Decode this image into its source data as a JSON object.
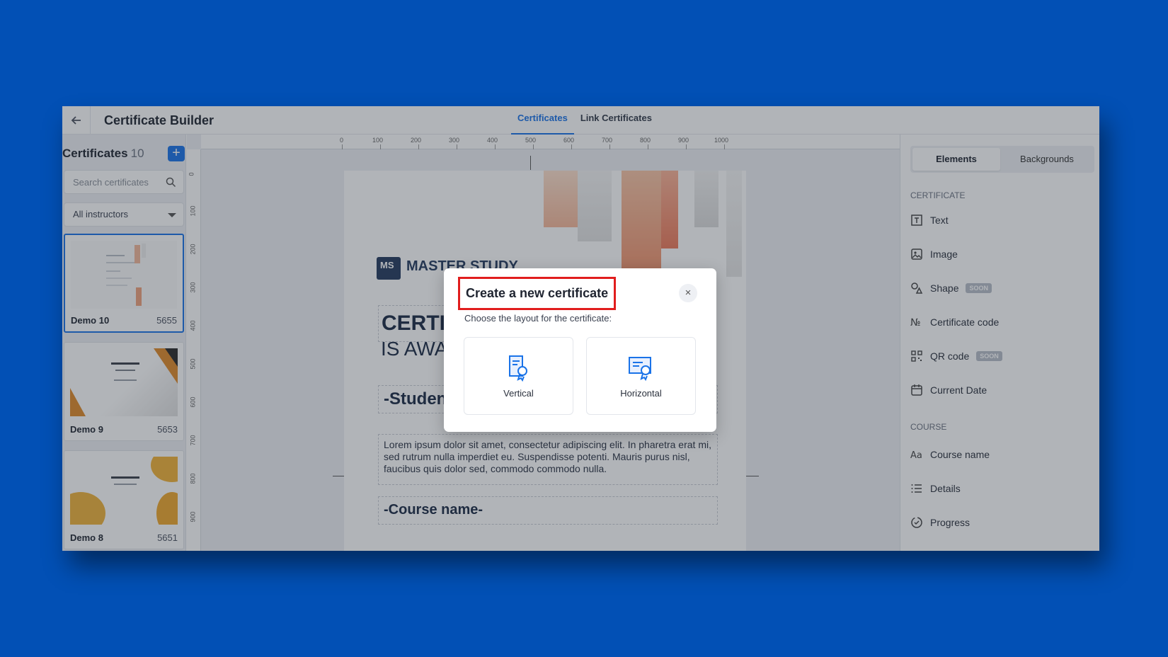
{
  "app": {
    "title": "Certificate Builder"
  },
  "tabs": [
    {
      "label": "Certificates",
      "active": true
    },
    {
      "label": "Link Certificates",
      "active": false
    }
  ],
  "sidebar": {
    "heading": "Certificates",
    "count": "10",
    "search_placeholder": "Search certificates",
    "instructor_filter": "All instructors",
    "certificates": [
      {
        "name": "Demo 10",
        "id": "5655",
        "selected": true
      },
      {
        "name": "Demo 9",
        "id": "5653",
        "selected": false
      },
      {
        "name": "Demo 8",
        "id": "5651",
        "selected": false
      }
    ]
  },
  "ruler": {
    "horizontal": [
      "0",
      "100",
      "200",
      "300",
      "400",
      "500",
      "600",
      "700",
      "800",
      "900",
      "1000"
    ],
    "vertical": [
      "0",
      "100",
      "200",
      "300",
      "400",
      "500",
      "600",
      "700",
      "800",
      "900"
    ]
  },
  "canvas": {
    "logo_mark": "MS",
    "logo_text": "MASTER STUDY",
    "title": "CERTIFICATE",
    "subtitle": "IS AWARDED TO",
    "student_placeholder": "-Student name-",
    "body_text": "Lorem ipsum dolor sit amet, consectetur adipiscing elit. In pharetra erat mi, sed rutrum nulla imperdiet eu. Suspendisse potenti. Mauris purus nisl, faucibus quis dolor sed, commodo commodo nulla.",
    "course_placeholder": "-Course name-"
  },
  "right_panel": {
    "tabs": [
      {
        "label": "Elements",
        "active": true
      },
      {
        "label": "Backgrounds",
        "active": false
      }
    ],
    "sections": [
      {
        "title": "CERTIFICATE",
        "items": [
          {
            "label": "Text",
            "icon": "text-icon"
          },
          {
            "label": "Image",
            "icon": "image-icon"
          },
          {
            "label": "Shape",
            "icon": "shape-icon",
            "badge": "SOON"
          },
          {
            "label": "Certificate code",
            "icon": "number-sign-icon"
          },
          {
            "label": "QR code",
            "icon": "qr-code-icon",
            "badge": "SOON"
          },
          {
            "label": "Current Date",
            "icon": "calendar-icon"
          }
        ]
      },
      {
        "title": "COURSE",
        "items": [
          {
            "label": "Course name",
            "icon": "font-icon"
          },
          {
            "label": "Details",
            "icon": "list-icon"
          },
          {
            "label": "Progress",
            "icon": "progress-icon"
          }
        ]
      }
    ]
  },
  "modal": {
    "title": "Create a new certificate",
    "subtitle": "Choose the layout for the certificate:",
    "close_label": "×",
    "options": [
      {
        "label": "Vertical"
      },
      {
        "label": "Horizontal"
      }
    ]
  },
  "colors": {
    "background": "#0250b5",
    "accent": "#1a73e8",
    "highlight": "#e11d1d"
  }
}
